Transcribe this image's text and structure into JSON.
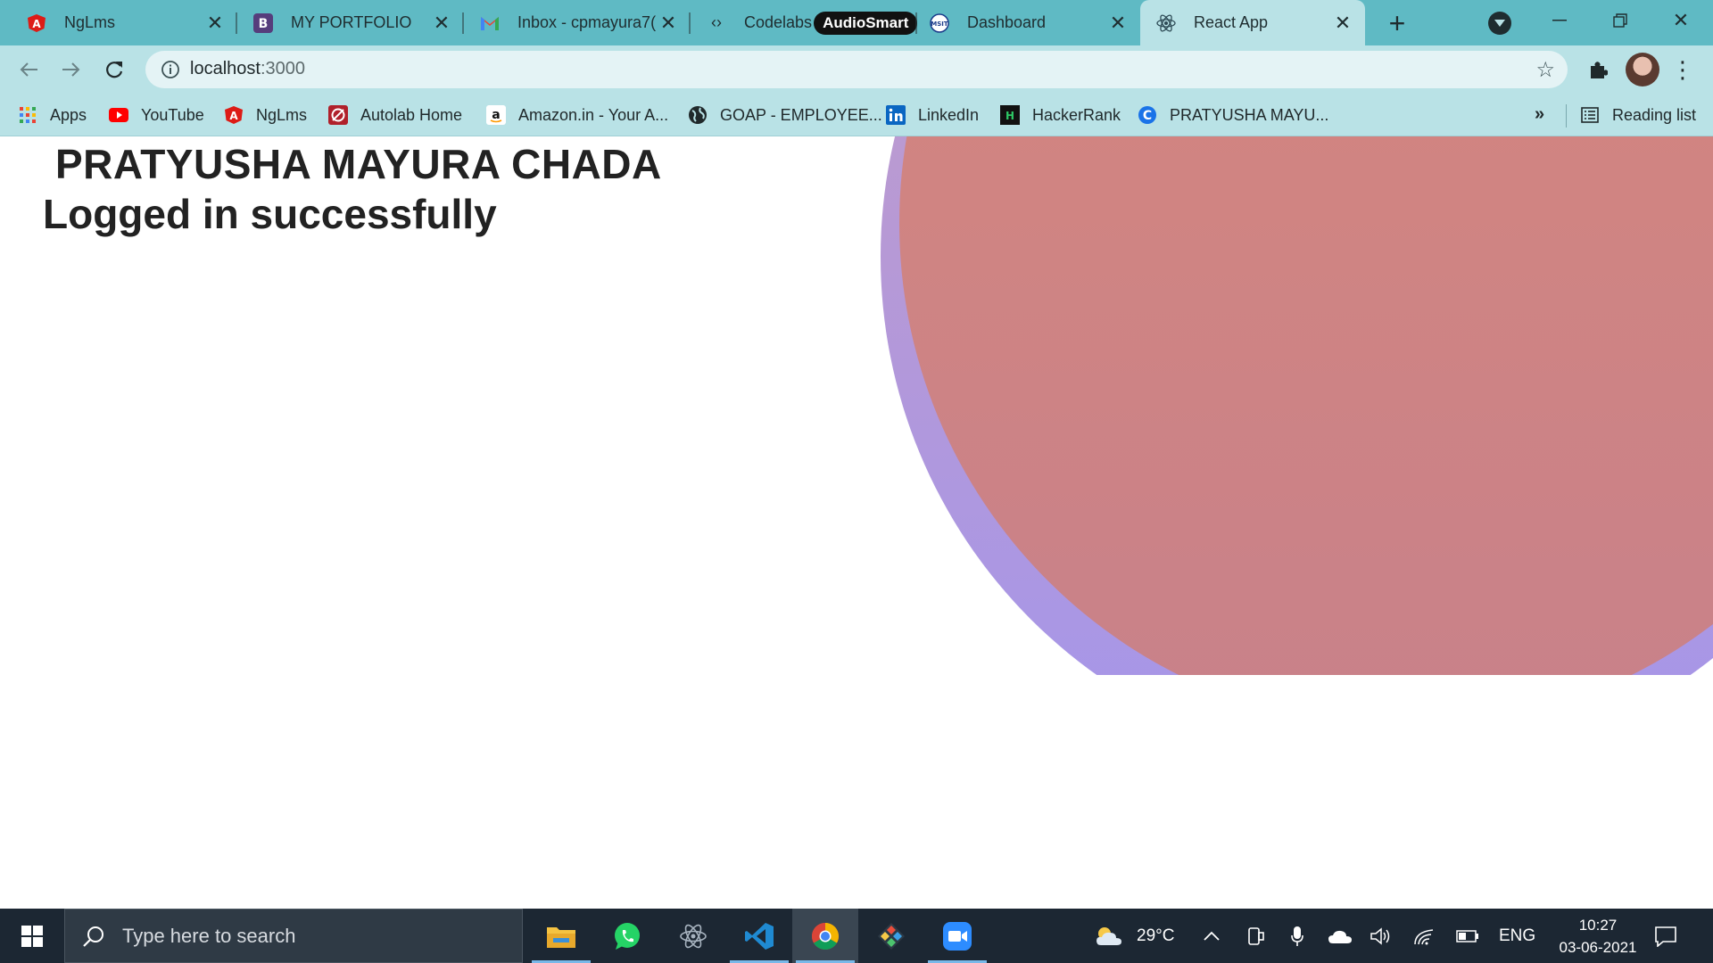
{
  "browser": {
    "tabs": [
      {
        "title": "NgLms",
        "icon": "angular-icon",
        "active": false
      },
      {
        "title": "MY PORTFOLIO",
        "icon": "bootstrap-icon",
        "active": false
      },
      {
        "title": "Inbox - cpmayura7(",
        "icon": "gmail-icon",
        "active": false
      },
      {
        "title": "Codelabs",
        "icon": "codelabs-icon",
        "active": false,
        "badge": "AudioSmart"
      },
      {
        "title": "Dashboard",
        "icon": "msit-icon",
        "active": false
      },
      {
        "title": "React App",
        "icon": "react-icon",
        "active": true
      }
    ],
    "new_tab": "+",
    "address": {
      "host": "localhost",
      "port": ":3000"
    },
    "bookmarks": [
      {
        "label": "Apps",
        "icon": "apps-grid-icon"
      },
      {
        "label": "YouTube",
        "icon": "youtube-icon"
      },
      {
        "label": "NgLms",
        "icon": "angular-icon"
      },
      {
        "label": "Autolab Home",
        "icon": "autolab-icon"
      },
      {
        "label": "Amazon.in - Your A...",
        "icon": "amazon-icon"
      },
      {
        "label": "GOAP - EMPLOYEE...",
        "icon": "globe-icon"
      },
      {
        "label": "LinkedIn",
        "icon": "linkedin-icon"
      },
      {
        "label": "HackerRank",
        "icon": "hackerrank-icon"
      },
      {
        "label": "PRATYUSHA MAYU...",
        "icon": "c-logo-icon"
      }
    ],
    "bookmarks_overflow": "»",
    "reading_list": "Reading list"
  },
  "page": {
    "name": "PRATYUSHA MAYURA CHADA",
    "message": "Logged in successfully",
    "colors": {
      "blob_outer": "#a596ea",
      "blob_inner": "#d7877b"
    }
  },
  "taskbar": {
    "search_placeholder": "Type here to search",
    "apps": [
      "file-explorer-icon",
      "whatsapp-icon",
      "electron-icon",
      "vscode-icon",
      "chrome-icon",
      "git-kraken-icon",
      "zoom-icon"
    ],
    "weather": "29°C",
    "language": "ENG",
    "time": "10:27",
    "date": "03-06-2021"
  }
}
